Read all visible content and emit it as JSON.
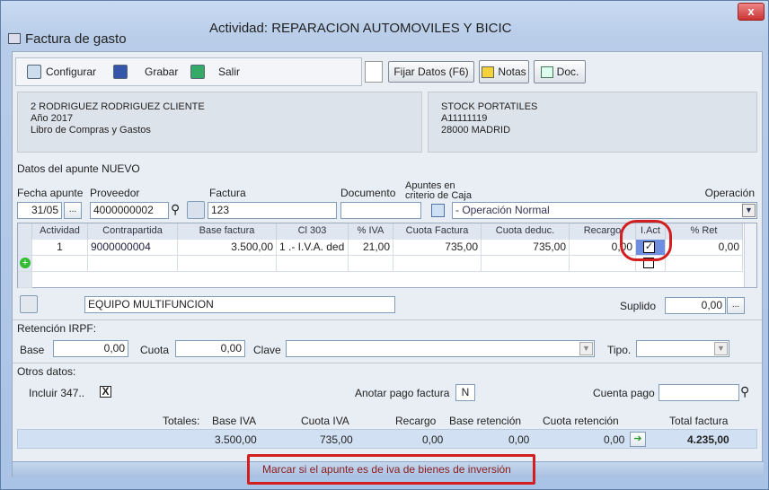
{
  "window": {
    "title": "Actividad: REPARACION AUTOMOVILES Y BICIC",
    "form_title": "Factura de gasto",
    "close_label": "x"
  },
  "toolbar": {
    "configurar": "Configurar",
    "grabar": "Grabar",
    "salir": "Salir",
    "fijar": "Fijar Datos (F6)",
    "notas": "Notas",
    "doc": "Doc."
  },
  "client": {
    "line1": "2 RODRIGUEZ RODRIGUEZ CLIENTE",
    "line2": "Año 2017",
    "line3": "Libro de Compras y Gastos"
  },
  "supplier": {
    "line1": "STOCK PORTATILES",
    "line2": "A11111119",
    "line3": "28000 MADRID"
  },
  "apunte": {
    "heading": "Datos del apunte NUEVO",
    "fecha_label": "Fecha apunte",
    "fecha": "31/05",
    "ellipsis": "...",
    "proveedor_label": "Proveedor",
    "proveedor": "4000000002",
    "factura_label": "Factura",
    "factura": "123",
    "documento_label": "Documento",
    "documento": "",
    "caja_label_1": "Apuntes en",
    "caja_label_2": "criterio de Caja",
    "operacion_label": "Operación",
    "operacion": "- Operación Normal"
  },
  "grid": {
    "headers": [
      "Actividad",
      "Contrapartida",
      "Base factura",
      "Cl 303",
      "% IVA",
      "Cuota Factura",
      "Cuota deduc.",
      "Recargo",
      "I.Act",
      "% Ret"
    ],
    "row": {
      "actividad": "1",
      "contrapartida": "9000000004",
      "base": "3.500,00",
      "cl303": "1 .- I.V.A. ded",
      "iva": "21,00",
      "cuota_factura": "735,00",
      "cuota_deduc": "735,00",
      "recargo": "0,00",
      "ret": "0,00"
    }
  },
  "concepto": {
    "text": "EQUIPO MULTIFUNCION",
    "suplido_label": "Suplido",
    "suplido": "0,00"
  },
  "irpf": {
    "heading": "Retención IRPF:",
    "base_label": "Base",
    "base": "0,00",
    "cuota_label": "Cuota",
    "cuota": "0,00",
    "clave_label": "Clave",
    "tipo_label": "Tipo."
  },
  "otros": {
    "heading": "Otros datos:",
    "incluir_label": "Incluir 347..",
    "incluir_mark": "X",
    "anotar_label": "Anotar pago factura",
    "anotar": "N",
    "cuenta_label": "Cuenta pago"
  },
  "totals": {
    "label": "Totales:",
    "base_label": "Base IVA",
    "cuota_label": "Cuota IVA",
    "recargo_label": "Recargo",
    "baseret_label": "Base retención",
    "cuotaret_label": "Cuota retención",
    "total_label": "Total factura",
    "base": "3.500,00",
    "cuota": "735,00",
    "recargo": "0,00",
    "baseret": "0,00",
    "cuotaret": "0,00",
    "total": "4.235,00"
  },
  "status": {
    "hint": "Marcar si el apunte es de iva de bienes de inversión"
  },
  "colors": {
    "highlight": "#d21e1e",
    "accent": "#5f88c0"
  }
}
